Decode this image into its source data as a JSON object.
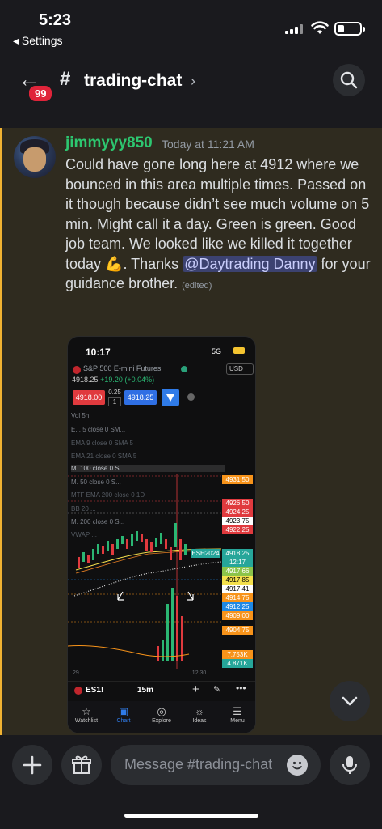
{
  "status_bar": {
    "time": "5:23",
    "back_label": "◂ Settings"
  },
  "header": {
    "unread_badge": "99",
    "channel_name": "trading-chat",
    "chevron": "›"
  },
  "message": {
    "username": "jimmyyy850",
    "timestamp": "Today at 11:21 AM",
    "text_before_emoji": "Could have gone long here at 4912 where we bounced in this area multiple times. Passed on it though because didn’t see much volume on 5 min. Might call it a day. Green is green. Good job team. We looked like we killed it together today ",
    "emoji": "💪",
    "text_after_emoji": ". Thanks ",
    "mention": "@Daytrading Danny",
    "text_end": " for your guidance brother.",
    "edited": "(edited)"
  },
  "attachment": {
    "time": "10:17",
    "network": "5G",
    "ticker_title": "S&P 500 E-mini Futures",
    "price": "4918.25",
    "change": "+19.20 (+0.04%)",
    "currency": "USD",
    "sell_price": "4918.00",
    "spread": "0.25",
    "quantity": "1",
    "buy_price": "4918.25",
    "indicators": [
      "Vol  5h",
      "E... 5 close 0 SM...",
      "EMA 9 close 0 SMA 5",
      "EMA 21 close 0 SMA 5",
      "M. 100 close 0 S...",
      "M. 50 close 0 S...",
      "MTF EMA 200 close 0 1D",
      "BB 20 ...",
      "M. 200 close 0 S...",
      "VWAP ..."
    ],
    "price_labels": [
      {
        "text": "4931.50",
        "color": "#f7931a"
      },
      {
        "text": "4926.50",
        "color": "#e03a3e"
      },
      {
        "text": "4924.25",
        "color": "#e03a3e"
      },
      {
        "text": "4923.75",
        "color": "#ffffff"
      },
      {
        "text": "4922.25",
        "color": "#e03a3e"
      },
      {
        "text": "4918.25",
        "color": "#26a69a"
      },
      {
        "text": "12:17",
        "color": "#26a69a"
      },
      {
        "text": "4917.66",
        "color": "#8bc34a"
      },
      {
        "text": "4917.85",
        "color": "#f4e04d"
      },
      {
        "text": "4917.41",
        "color": "#ffffff"
      },
      {
        "text": "4914.75",
        "color": "#f7931a"
      },
      {
        "text": "4912.25",
        "color": "#1e88e5"
      },
      {
        "text": "4909.00",
        "color": "#f7931a"
      },
      {
        "text": "4904.75",
        "color": "#f7931a"
      },
      {
        "text": "7.753K",
        "color": "#f7931a"
      },
      {
        "text": "4.871K",
        "color": "#26a69a"
      }
    ],
    "contract_tag": "ESH2024",
    "x_axis": [
      "29",
      "",
      "12:30"
    ],
    "symbol": "ES1!",
    "timeframe": "15m",
    "nav": [
      "Watchlist",
      "Chart",
      "Explore",
      "Ideas",
      "Menu"
    ]
  },
  "composer": {
    "placeholder": "Message #trading-chat"
  }
}
